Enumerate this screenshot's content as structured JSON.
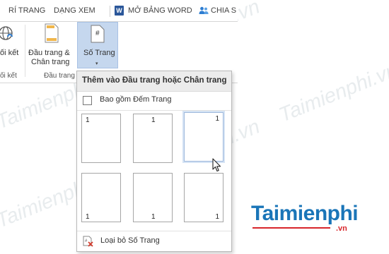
{
  "tabs": [
    {
      "label": "RÍ TRANG"
    },
    {
      "label": "DẠNG XEM"
    },
    {
      "label": "MỞ BẢNG WORD"
    },
    {
      "label": "CHIA S"
    }
  ],
  "ribbon": {
    "link_button": {
      "label": "ối kết"
    },
    "link_group_label": "ối kết",
    "header_footer_button": {
      "line1": "Đầu trang &",
      "line2": "Chân trang"
    },
    "header_footer_group_label": "Đầu trang",
    "page_number_button": {
      "label": "Số Trang",
      "icon_text": "#"
    }
  },
  "dropdown": {
    "header": "Thêm vào Đầu trang hoặc Chân trang",
    "checkbox_label": "Bao gồm Đếm Trang",
    "checkbox_checked": false,
    "thumbnails": [
      {
        "number": "1",
        "position": "top-left"
      },
      {
        "number": "1",
        "position": "top-center"
      },
      {
        "number": "1",
        "position": "top-right",
        "selected": true
      },
      {
        "number": "1",
        "position": "bottom-left"
      },
      {
        "number": "1",
        "position": "bottom-center"
      },
      {
        "number": "1",
        "position": "bottom-right"
      }
    ],
    "remove_label": "Loại bỏ Số Trang"
  },
  "watermark": {
    "text": "Taimienphi.vn"
  },
  "brand": {
    "name": "Taimienphi",
    "suffix": ".vn",
    "color": "#1a75b8",
    "accent": "#d8252b"
  },
  "colors": {
    "active_button": "#c5d7ee",
    "word_blue": "#2b579a"
  }
}
